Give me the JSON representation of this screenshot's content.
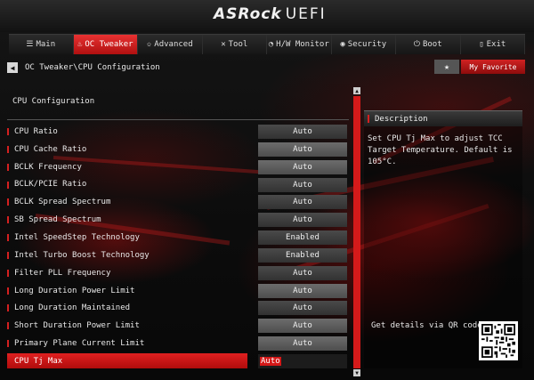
{
  "header": {
    "brand": "ASRock",
    "product": "UEFI"
  },
  "nav": {
    "tabs": [
      {
        "label": "Main",
        "icon": "list-icon",
        "active": false
      },
      {
        "label": "OC Tweaker",
        "icon": "flame-icon",
        "active": true
      },
      {
        "label": "Advanced",
        "icon": "star-icon",
        "active": false
      },
      {
        "label": "Tool",
        "icon": "wrench-icon",
        "active": false
      },
      {
        "label": "H/W Monitor",
        "icon": "gauge-icon",
        "active": false
      },
      {
        "label": "Security",
        "icon": "shield-icon",
        "active": false
      },
      {
        "label": "Boot",
        "icon": "power-icon",
        "active": false
      },
      {
        "label": "Exit",
        "icon": "door-icon",
        "active": false
      }
    ]
  },
  "breadcrumb": {
    "path": "OC Tweaker\\CPU Configuration",
    "favorite_label": "My Favorite"
  },
  "main": {
    "section_title": "CPU Configuration",
    "items": [
      {
        "label": "CPU Ratio",
        "value": "Auto",
        "style": "normal"
      },
      {
        "label": "CPU Cache Ratio",
        "value": "Auto",
        "style": "alt"
      },
      {
        "label": "BCLK Frequency",
        "value": "Auto",
        "style": "alt"
      },
      {
        "label": "BCLK/PCIE Ratio",
        "value": "Auto",
        "style": "normal"
      },
      {
        "label": "BCLK Spread Spectrum",
        "value": "Auto",
        "style": "normal"
      },
      {
        "label": "SB Spread Spectrum",
        "value": "Auto",
        "style": "normal"
      },
      {
        "label": "Intel SpeedStep Technology",
        "value": "Enabled",
        "style": "normal"
      },
      {
        "label": "Intel Turbo Boost Technology",
        "value": "Enabled",
        "style": "normal"
      },
      {
        "label": "Filter PLL Frequency",
        "value": "Auto",
        "style": "normal"
      },
      {
        "label": "Long Duration Power Limit",
        "value": "Auto",
        "style": "alt"
      },
      {
        "label": "Long Duration Maintained",
        "value": "Auto",
        "style": "normal"
      },
      {
        "label": "Short Duration Power Limit",
        "value": "Auto",
        "style": "alt"
      },
      {
        "label": "Primary Plane Current Limit",
        "value": "Auto",
        "style": "alt"
      },
      {
        "label": "CPU Tj Max",
        "value": "Auto",
        "style": "selected"
      }
    ]
  },
  "description": {
    "title": "Description",
    "text": "Set CPU Tj Max to adjust TCC Target Temperature. Default is 105°C.",
    "qr_label": "Get details via QR code"
  },
  "colors": {
    "accent": "#d41a1a",
    "background": "#0a0a0a"
  }
}
